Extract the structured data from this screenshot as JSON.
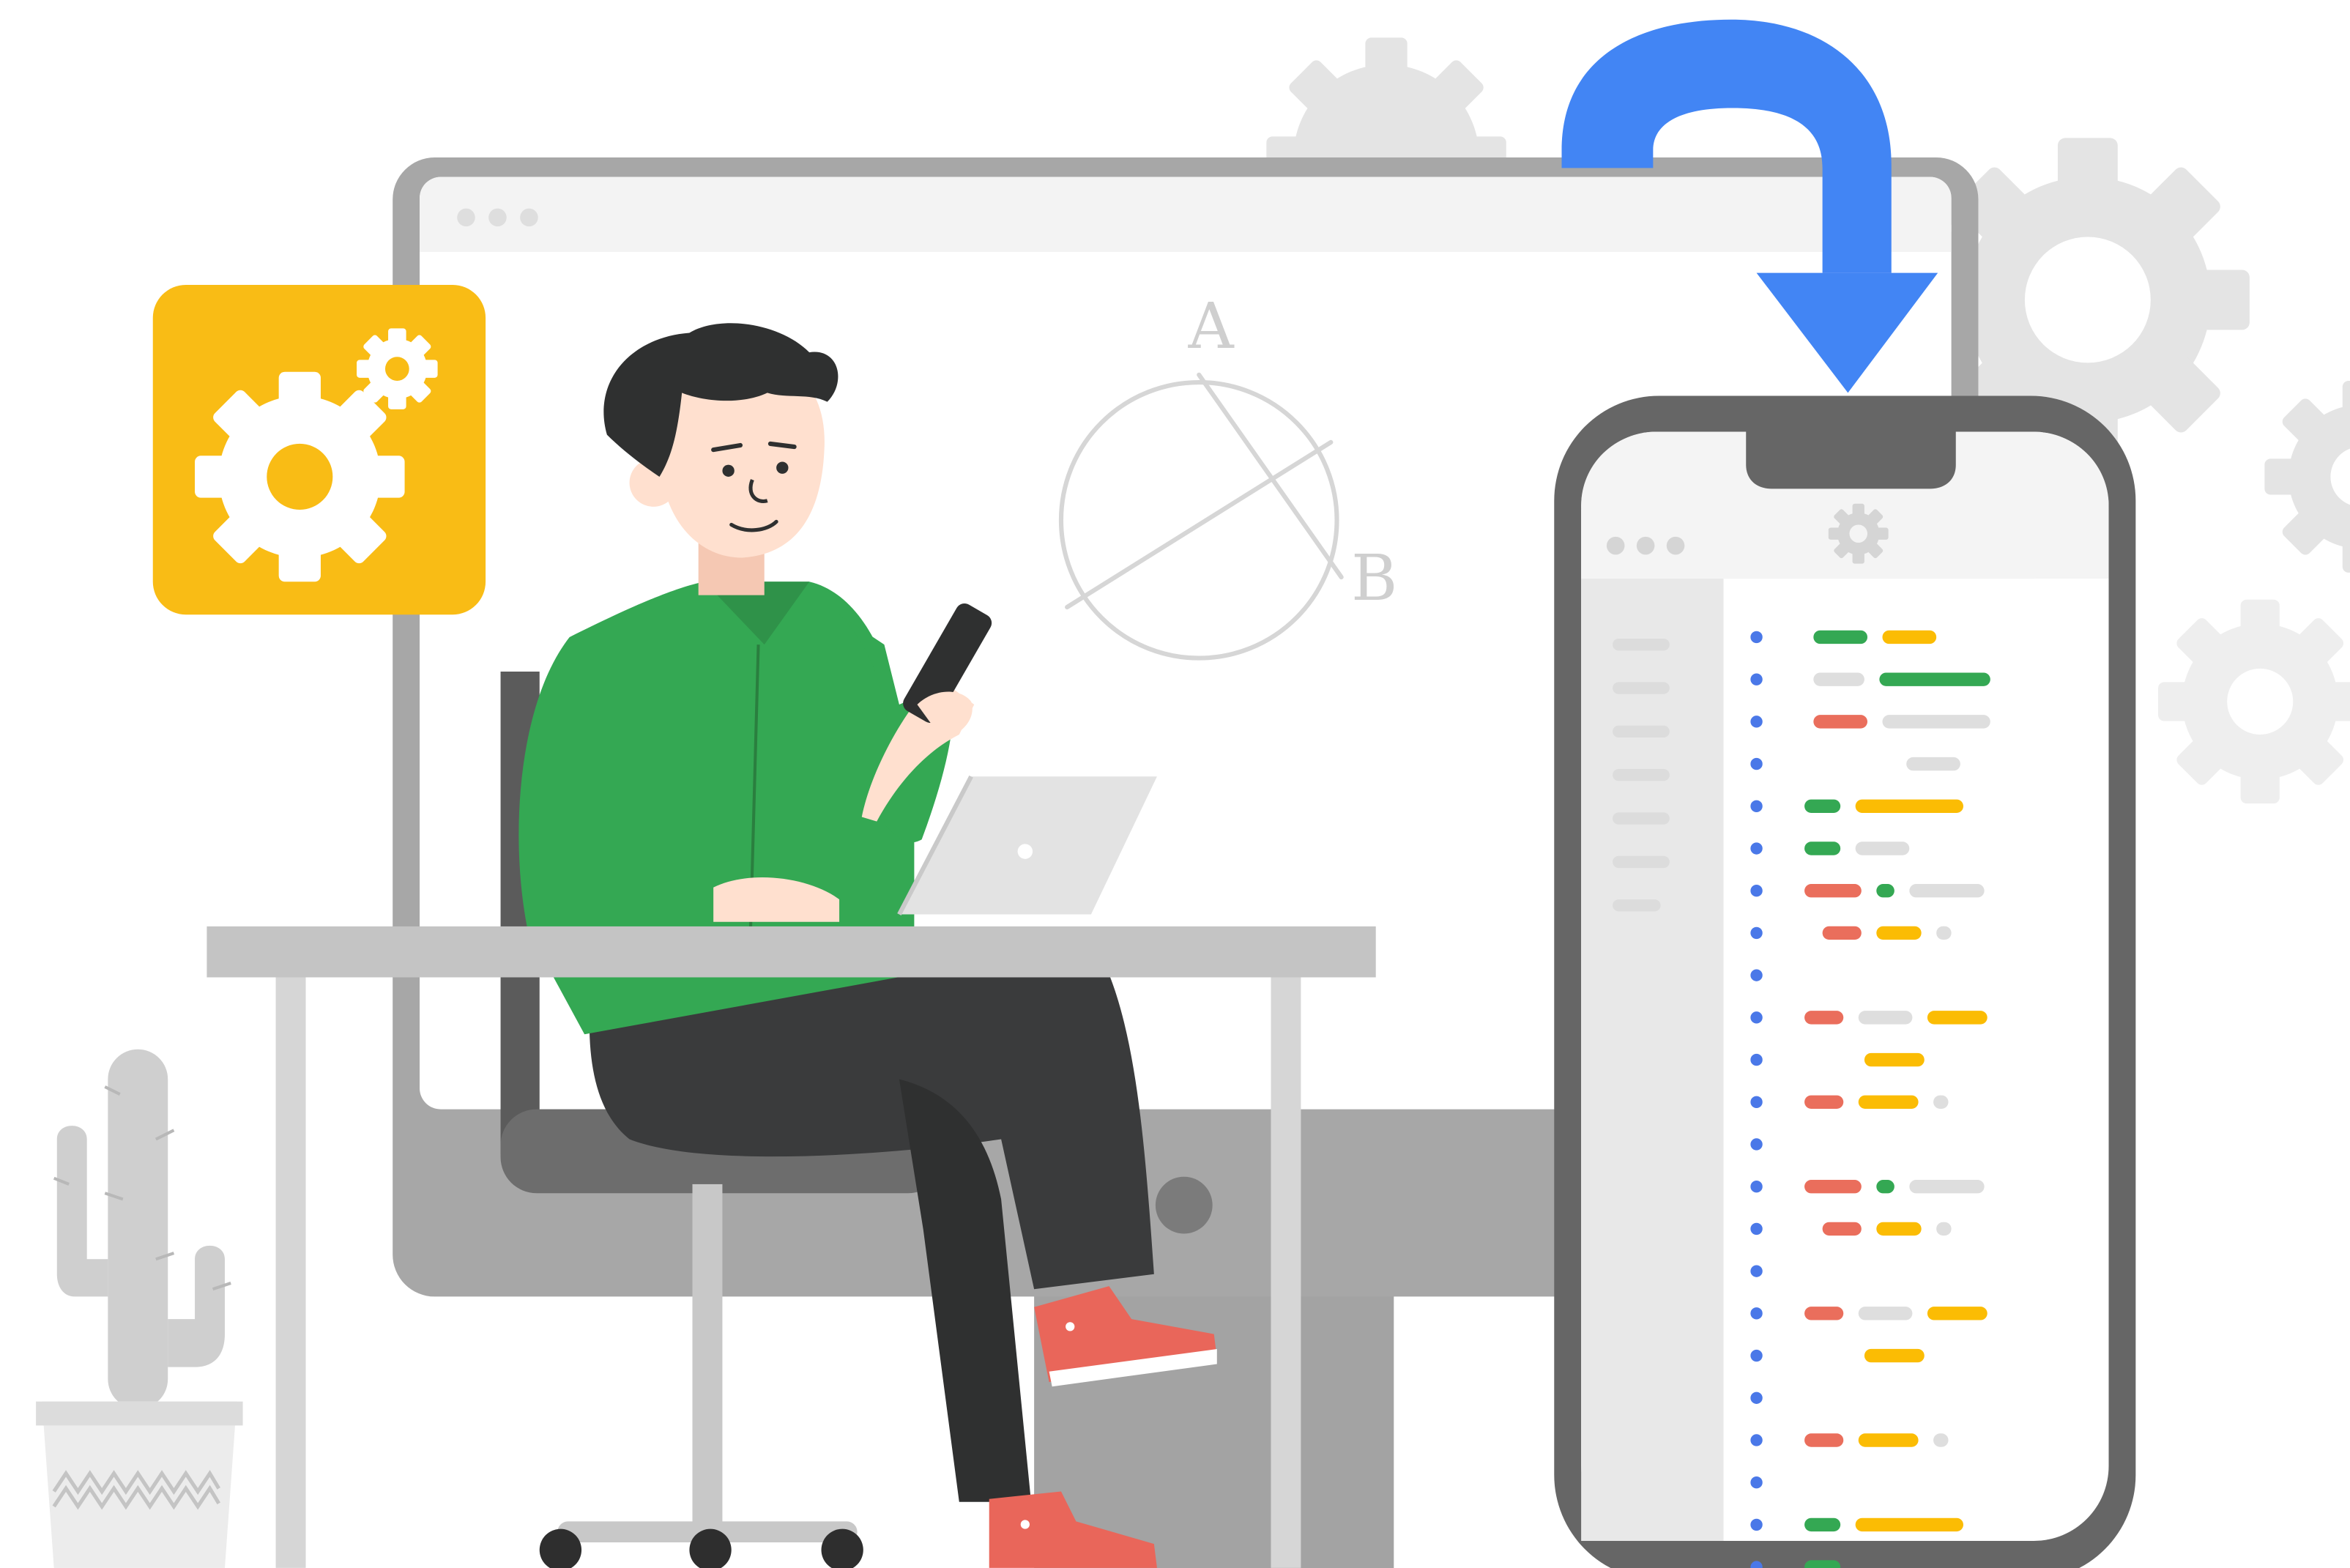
{
  "colors": {
    "background": "#ffffff",
    "monitor_frame": "#a7a7a7",
    "monitor_stand": "#9a9a9a",
    "screen": "#ffffff",
    "titlebar": "#f3f3f3",
    "gear_tile": "#f9bc15",
    "gear_white": "#ffffff",
    "arrow_blue": "#4285f4",
    "phone_frame": "#666666",
    "phone_sidebar": "#e8e8e8",
    "shirt_green": "#34a853",
    "pants_dark": "#3a3b3c",
    "shoe_red": "#e9665a",
    "hair": "#2f3030",
    "skin": "#ffe0cf",
    "desk": "#c4c4c4",
    "chair": "#6d6d6d",
    "cactus": "#cfcfcf",
    "code_green": "#34a853",
    "code_yellow": "#fbbc04",
    "code_red": "#ea6e5c",
    "code_gray": "#dedede",
    "code_dot_blue": "#4a78e8"
  },
  "icons": {
    "settings_tile": "gear-icon",
    "phone_header": "gear-icon",
    "transfer_arrow": "curved-arrow-down-icon"
  },
  "diagram": {
    "label_a": "A",
    "label_b": "B"
  },
  "code_lines": [
    [
      [
        "green",
        0.18
      ],
      [
        "yellow",
        0.18
      ]
    ],
    [
      [
        "gray",
        0.17
      ],
      [
        "green",
        0.37
      ]
    ],
    [
      [
        "red",
        0.18
      ],
      [
        "gray",
        0.36
      ]
    ],
    [
      [
        "gray",
        0.18,
        0.36
      ]
    ],
    [
      [
        "green",
        0.12,
        0.02
      ],
      [
        "yellow",
        0.36
      ]
    ],
    [
      [
        "green",
        0.12,
        0.02
      ],
      [
        "gray",
        0.18
      ]
    ],
    [
      [
        "red",
        0.19,
        0.02
      ],
      [
        "green",
        0.06
      ],
      [
        "gray",
        0.25
      ]
    ],
    [
      [
        "red",
        0.13,
        0.08
      ],
      [
        "yellow",
        0.15
      ],
      [
        "gray",
        0.05
      ]
    ],
    [],
    [
      [
        "red",
        0.13,
        0.02
      ],
      [
        "gray",
        0.18
      ],
      [
        "yellow",
        0.2
      ]
    ],
    [
      [
        "yellow",
        0.2,
        0.22
      ]
    ],
    [
      [
        "red",
        0.13,
        0.02
      ],
      [
        "yellow",
        0.2
      ],
      [
        "gray",
        0.05
      ]
    ],
    [],
    [
      [
        "red",
        0.19,
        0.02
      ],
      [
        "green",
        0.06
      ],
      [
        "gray",
        0.25
      ]
    ],
    [
      [
        "red",
        0.13,
        0.08
      ],
      [
        "yellow",
        0.15
      ],
      [
        "gray",
        0.05
      ]
    ],
    [],
    [
      [
        "red",
        0.13,
        0.02
      ],
      [
        "gray",
        0.18
      ],
      [
        "yellow",
        0.2
      ]
    ],
    [
      [
        "yellow",
        0.2,
        0.22
      ]
    ],
    [],
    [
      [
        "red",
        0.13,
        0.02
      ],
      [
        "yellow",
        0.2
      ],
      [
        "gray",
        0.05
      ]
    ],
    [],
    [
      [
        "green",
        0.12,
        0.02
      ],
      [
        "yellow",
        0.36
      ]
    ],
    [
      [
        "green",
        0.12,
        0.02
      ]
    ]
  ]
}
